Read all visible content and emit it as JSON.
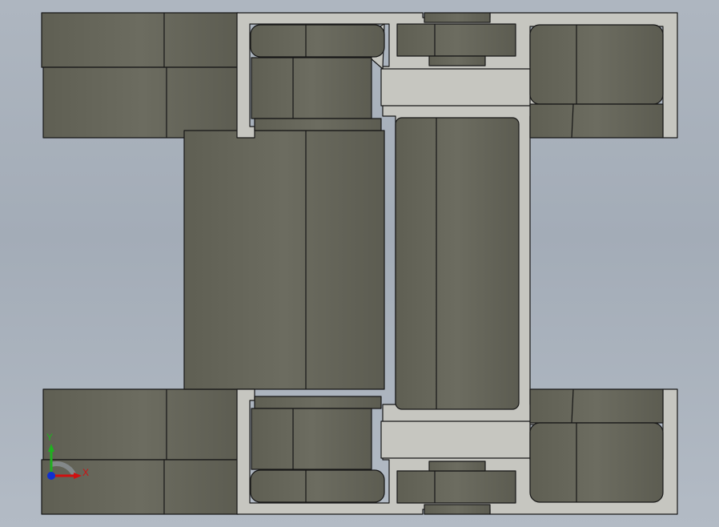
{
  "viewport": {
    "background_top": "#aeb6c0",
    "background_bottom": "#b3bbc5"
  },
  "model": {
    "housing_color": "#c6c6c0",
    "part_color": "#676759",
    "part_highlight": "#727268",
    "edge_color": "#161616"
  },
  "triad": {
    "x_label": "X",
    "y_label": "Y",
    "x_color": "#d01010",
    "y_color": "#20b020",
    "z_color": "#1030d0"
  }
}
